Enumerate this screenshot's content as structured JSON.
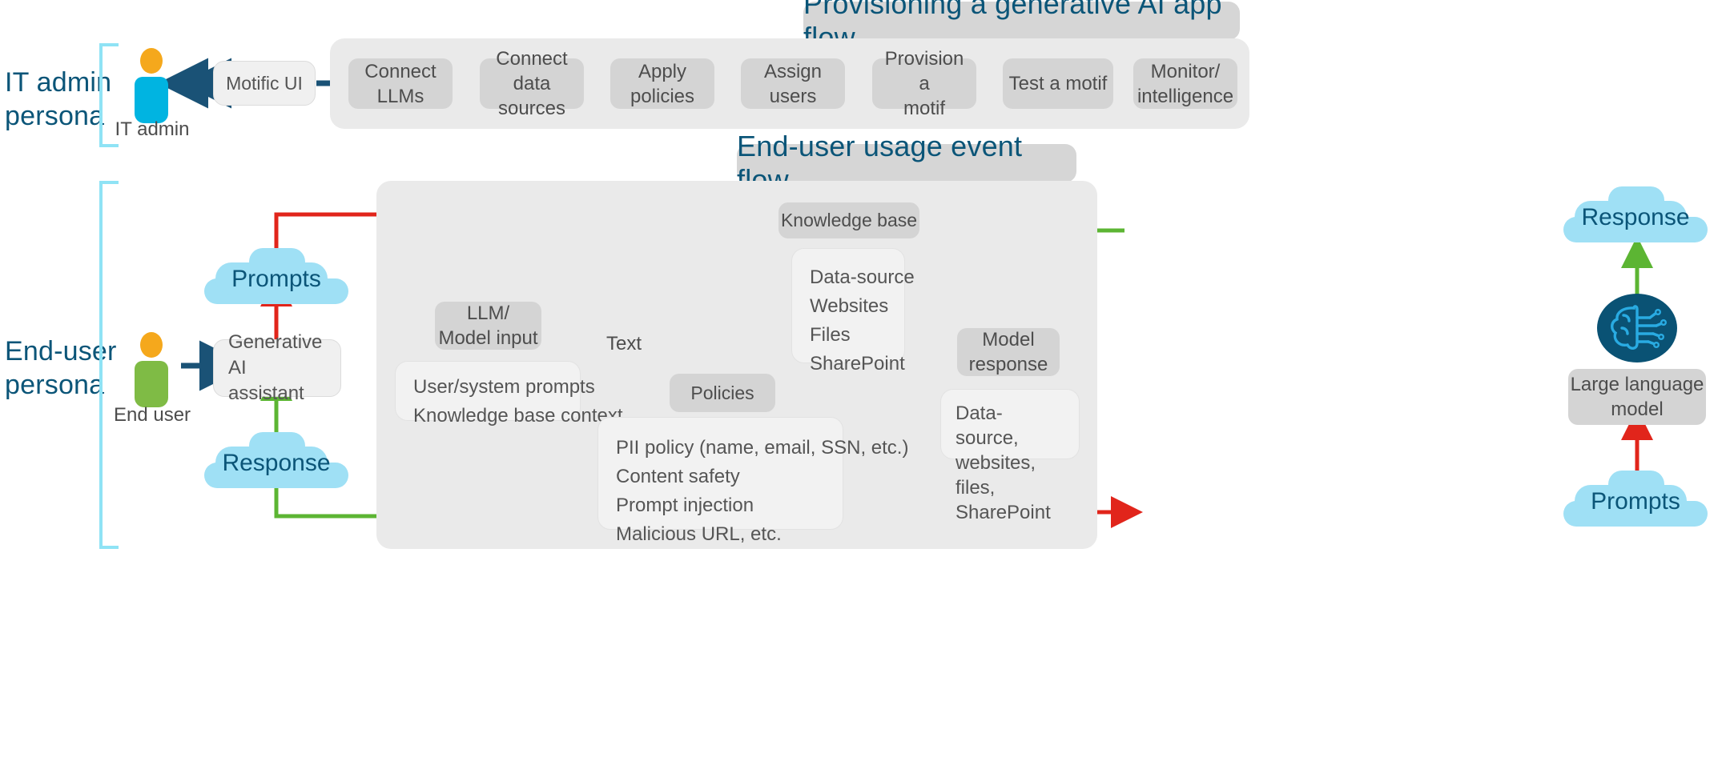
{
  "colors": {
    "navy": "#0B5578",
    "cyan_light": "#9FE0F5",
    "bracket": "#8FE3F5",
    "orange": "#F5A81C",
    "admin_blue": "#00B4E1",
    "user_green": "#7FBB45",
    "arrow_navy": "#1A5276",
    "red": "#E1251B",
    "green": "#5CB533",
    "band_gray": "#EAEAEA",
    "banner_gray": "#D6D6D6",
    "node_gray": "#D4D4D4",
    "node_light": "#F0F0F0",
    "brain_circle": "#0A5274",
    "brain_cyan": "#29ABE2",
    "text_gray": "#4D4D4D"
  },
  "personas": {
    "it_admin": {
      "label": "IT admin\npersona",
      "figure_caption": "IT admin"
    },
    "end_user": {
      "label": "End-user\npersona",
      "figure_caption": "End user"
    }
  },
  "admin_flow": {
    "banner": "Provisioning a generative AI app flow",
    "entry_node": "Motific UI",
    "steps": [
      {
        "label": "Connect\nLLMs"
      },
      {
        "label": "Connect data\nsources"
      },
      {
        "label": "Apply\npolicies"
      },
      {
        "label": "Assign users"
      },
      {
        "label": "Provision a\nmotif"
      },
      {
        "label": "Test a motif"
      },
      {
        "label": "Monitor/\nintelligence"
      }
    ]
  },
  "user_flow": {
    "banner": "End-user usage event flow",
    "assistant_node": "Generative AI\nassistant",
    "clouds": {
      "prompts_left": "Prompts",
      "response_left": "Response",
      "response_right": "Response",
      "prompts_right": "Prompts"
    },
    "knowledge_base": "Knowledge base",
    "data_sources": [
      "Data-source",
      "Websites",
      "Files",
      "SharePoint"
    ],
    "llm_input": "LLM/\nModel input",
    "llm_input_details": [
      "User/system prompts",
      "Knowledge base context"
    ],
    "edge_label_text": "Text",
    "policies_node": "Policies",
    "policies": [
      "PII policy (name, email, SSN, etc.)",
      "Content safety",
      "Prompt injection",
      "Malicious URL, etc."
    ],
    "model_response": "Model\nresponse",
    "model_response_details": "Data-source,\nwebsites, files,\nSharePoint",
    "large_language_model": "Large language\nmodel",
    "brain_icon": "brain-circuit-icon"
  }
}
